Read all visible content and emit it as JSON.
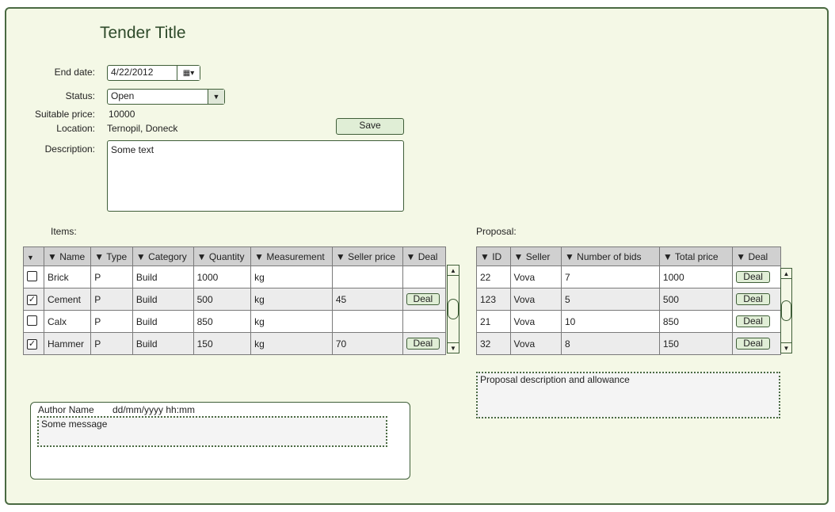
{
  "page": {
    "title": "Tender Title"
  },
  "form": {
    "end_date_label": "End date:",
    "end_date_value": "4/22/2012",
    "status_label": "Status:",
    "status_value": "Open",
    "price_label": "Suitable price:",
    "price_value": "10000",
    "location_label": "Location:",
    "location_value": "Ternopil, Doneck",
    "description_label": "Description:",
    "description_value": "Some text",
    "save_label": "Save",
    "calendar_icon": "calendar-icon",
    "dropdown_icon": "chevron-down-icon"
  },
  "items": {
    "label": "Items:",
    "headers": [
      "▼",
      "▼ Name",
      "▼ Type",
      "▼ Category",
      "▼ Quantity",
      "▼ Measurement",
      "▼ Seller price",
      "▼ Deal"
    ],
    "rows": [
      {
        "checked": false,
        "name": "Brick",
        "type": "P",
        "category": "Build",
        "quantity": "1000",
        "measurement": "kg",
        "seller_price": "",
        "deal": ""
      },
      {
        "checked": true,
        "name": "Cement",
        "type": "P",
        "category": "Build",
        "quantity": "500",
        "measurement": "kg",
        "seller_price": "45",
        "deal": "Deal"
      },
      {
        "checked": false,
        "name": "Calx",
        "type": "P",
        "category": "Build",
        "quantity": "850",
        "measurement": "kg",
        "seller_price": "",
        "deal": ""
      },
      {
        "checked": true,
        "name": "Hammer",
        "type": "P",
        "category": "Build",
        "quantity": "150",
        "measurement": "kg",
        "seller_price": "70",
        "deal": "Deal"
      }
    ]
  },
  "proposal": {
    "label": "Proposal:",
    "headers": [
      "▼ ID",
      "▼ Seller",
      "▼ Number of bids",
      "▼ Total price",
      "▼ Deal"
    ],
    "rows": [
      {
        "id": "22",
        "seller": "Vova",
        "bids": "7",
        "total": "1000",
        "deal": "Deal"
      },
      {
        "id": "123",
        "seller": "Vova",
        "bids": "5",
        "total": "500",
        "deal": "Deal"
      },
      {
        "id": "21",
        "seller": "Vova",
        "bids": "10",
        "total": "850",
        "deal": "Deal"
      },
      {
        "id": "32",
        "seller": "Vova",
        "bids": "8",
        "total": "150",
        "deal": "Deal"
      }
    ],
    "description": "Proposal description and allowance"
  },
  "message": {
    "author": "Author Name",
    "datetime": "dd/mm/yyyy hh:mm",
    "text": "Some message"
  },
  "colors": {
    "background": "#f4f8e6",
    "border": "#4a6a42",
    "button": "#e0eed6",
    "header": "#d0d0d0"
  }
}
